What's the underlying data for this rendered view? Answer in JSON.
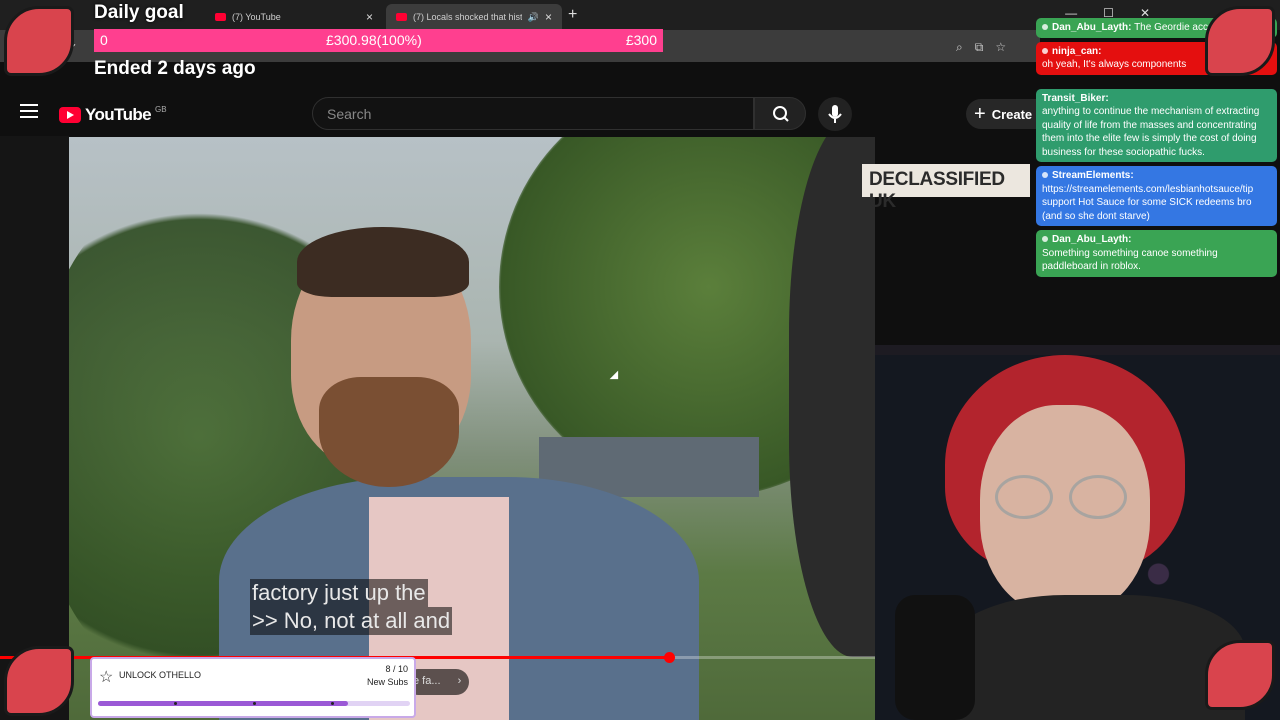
{
  "browser": {
    "tabs": [
      {
        "label": "(7) YouTube"
      },
      {
        "label": "(7) Locals shocked that hist"
      }
    ]
  },
  "donation_goal": {
    "title": "Daily goal",
    "start": "0",
    "current": "£300.98(100%)",
    "target": "£300",
    "progress_fraction": 1.0,
    "status": "Ended 2 days ago",
    "bar_color": "#ff3f8f"
  },
  "youtube": {
    "logo_text": "YouTube",
    "region": "GB",
    "search_placeholder": "Search",
    "create_label": "Create"
  },
  "video": {
    "watermark": "DECLASSIFIED UK",
    "captions": [
      "factory just up the",
      ">> No, not at all and"
    ],
    "chapter_label": "e fa...",
    "progress_fraction": 0.765
  },
  "chat": {
    "messages": [
      {
        "user": "Dan_Abu_Layth:",
        "text": "The Geordie accent =]",
        "color": "#3aa454"
      },
      {
        "user": "ninja_can:",
        "text": "oh yeah, It's always components",
        "color": "#e40f0f"
      },
      {
        "user": "Transit_Biker:",
        "text": "anything to continue the mechanism of extracting quality of life from the masses and concentrating them into the elite few is simply the cost of doing business for these sociopathic fucks.",
        "color": "#2f9c6d"
      },
      {
        "user": "StreamElements:",
        "text": "https://streamelements.com/lesbianhotsauce/tip support Hot Sauce for some SICK redeems bro (and so she dont starve)",
        "color": "#3477e3"
      },
      {
        "user": "Dan_Abu_Layth:",
        "text": "Something something canoe something paddleboard in roblox.",
        "color": "#3aa454"
      }
    ]
  },
  "sub_goal": {
    "label": "UNLOCK OTHELLO",
    "count": "8 / 10",
    "unit": "New Subs",
    "progress_fraction": 0.8
  }
}
